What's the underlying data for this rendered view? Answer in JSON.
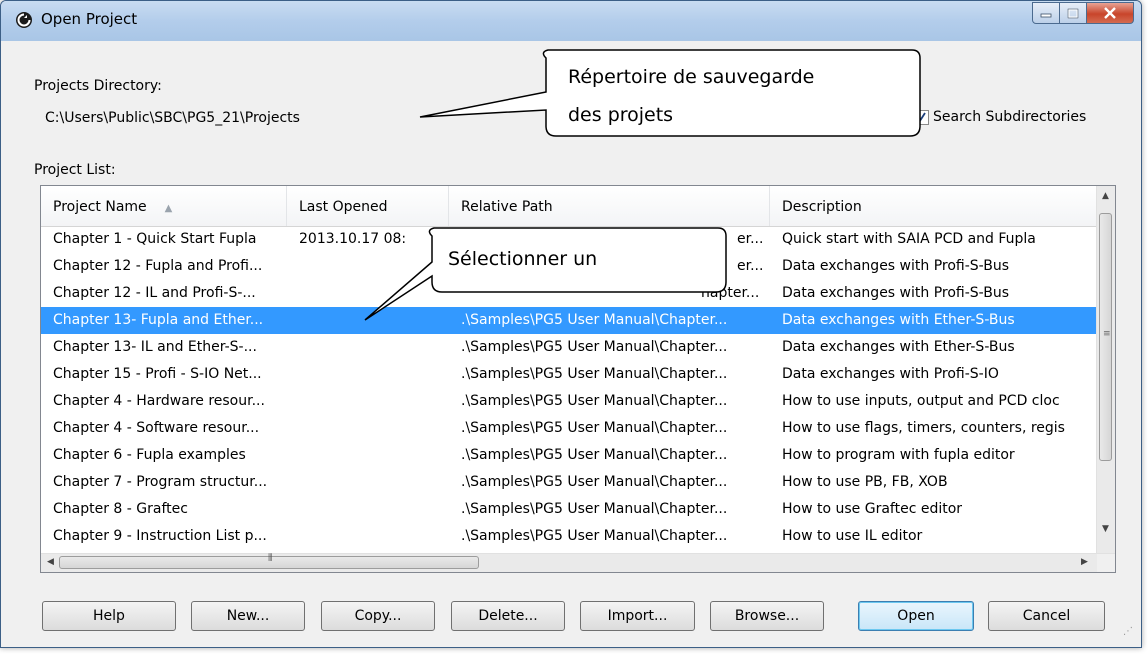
{
  "window": {
    "title": "Open Project"
  },
  "directory": {
    "label": "Projects Directory:",
    "value": "C:\\Users\\Public\\SBC\\PG5_21\\Projects"
  },
  "search_subdirectories": {
    "label": "Search Subdirectories",
    "checked": true
  },
  "project_list": {
    "label": "Project List:",
    "columns": [
      "Project Name",
      "Last Opened",
      "Relative Path",
      "Description"
    ],
    "sorted_column": "Project Name",
    "rows": [
      [
        "Chapter 1 - Quick Start Fupla",
        "2013.10.17  08:",
        "",
        "Quick start with SAIA PCD and Fupla"
      ],
      [
        "Chapter 12 - Fupla and Profi...",
        "",
        "",
        "Data exchanges with Profi-S-Bus"
      ],
      [
        "Chapter 12 - IL and Profi-S-...",
        "",
        "",
        "Data exchanges with Profi-S-Bus"
      ],
      [
        "Chapter 13- Fupla and Ether...",
        "",
        ".\\Samples\\PG5 User Manual\\Chapter...",
        "Data exchanges with Ether-S-Bus"
      ],
      [
        "Chapter 13- IL and Ether-S-...",
        "",
        ".\\Samples\\PG5 User Manual\\Chapter...",
        "Data exchanges with Ether-S-Bus"
      ],
      [
        "Chapter 15 - Profi - S-IO Net...",
        "",
        ".\\Samples\\PG5 User Manual\\Chapter...",
        "Data exchanges  with Profi-S-IO"
      ],
      [
        "Chapter 4 - Hardware resour...",
        "",
        ".\\Samples\\PG5 User Manual\\Chapter...",
        "How to use inputs, output and PCD cloc"
      ],
      [
        "Chapter 4 - Software  resour...",
        "",
        ".\\Samples\\PG5 User Manual\\Chapter...",
        "How to use flags, timers, counters, regis"
      ],
      [
        "Chapter 6 - Fupla examples",
        "",
        ".\\Samples\\PG5 User Manual\\Chapter...",
        "How to program with fupla editor"
      ],
      [
        "Chapter 7 - Program structur...",
        "",
        ".\\Samples\\PG5 User Manual\\Chapter...",
        "How to use  PB, FB, XOB"
      ],
      [
        "Chapter 8 - Graftec",
        "",
        ".\\Samples\\PG5 User Manual\\Chapter...",
        "How to  use Graftec editor"
      ],
      [
        "Chapter 9 - Instruction List p...",
        "",
        ".\\Samples\\PG5 User Manual\\Chapter...",
        "How to use IL editor"
      ]
    ],
    "selected_row": 3,
    "partial_path_fragments": [
      "er...",
      "er...",
      "hapter..."
    ]
  },
  "buttons": {
    "help": "Help",
    "new": "New...",
    "copy": "Copy...",
    "delete": "Delete...",
    "import": "Import...",
    "browse": "Browse...",
    "open": "Open",
    "cancel": "Cancel"
  },
  "callouts": {
    "directory_line1": "Répertoire de sauvegarde",
    "directory_line2": "des projets",
    "select": "Sélectionner un"
  },
  "colors": {
    "selection": "#3399ff",
    "title_bar": "#b3cdeb",
    "close_button": "#c8452b"
  }
}
